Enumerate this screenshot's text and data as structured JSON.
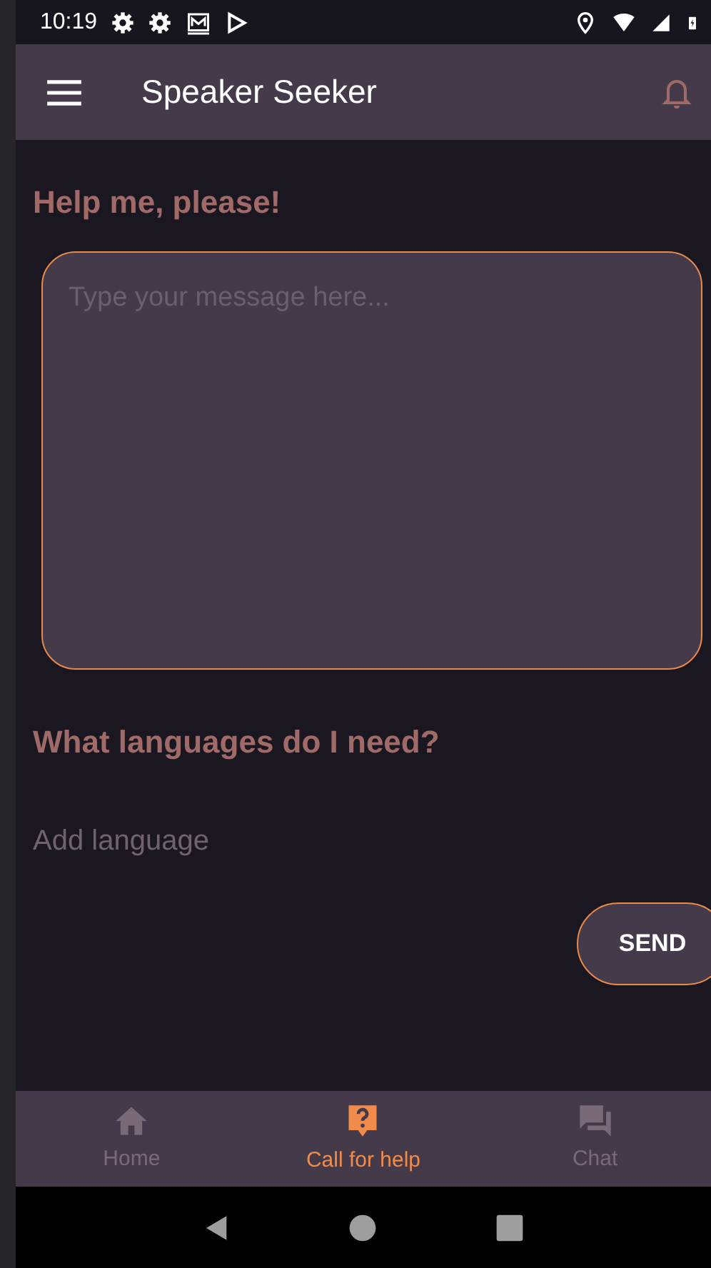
{
  "status_bar": {
    "time": "10:19"
  },
  "app_bar": {
    "title": "Speaker Seeker"
  },
  "help_section": {
    "heading": "Help me, please!",
    "message": {
      "placeholder": "Type your message here..."
    }
  },
  "languages_section": {
    "heading": "What languages do I need?",
    "language_field": {
      "placeholder": "Add language"
    }
  },
  "send_button": {
    "label": "SEND"
  },
  "bottom_nav": [
    {
      "kind": "home",
      "label": "Home",
      "selected": false
    },
    {
      "kind": "help",
      "label": "Call for help",
      "selected": true
    },
    {
      "kind": "chat",
      "label": "Chat",
      "selected": false
    }
  ]
}
